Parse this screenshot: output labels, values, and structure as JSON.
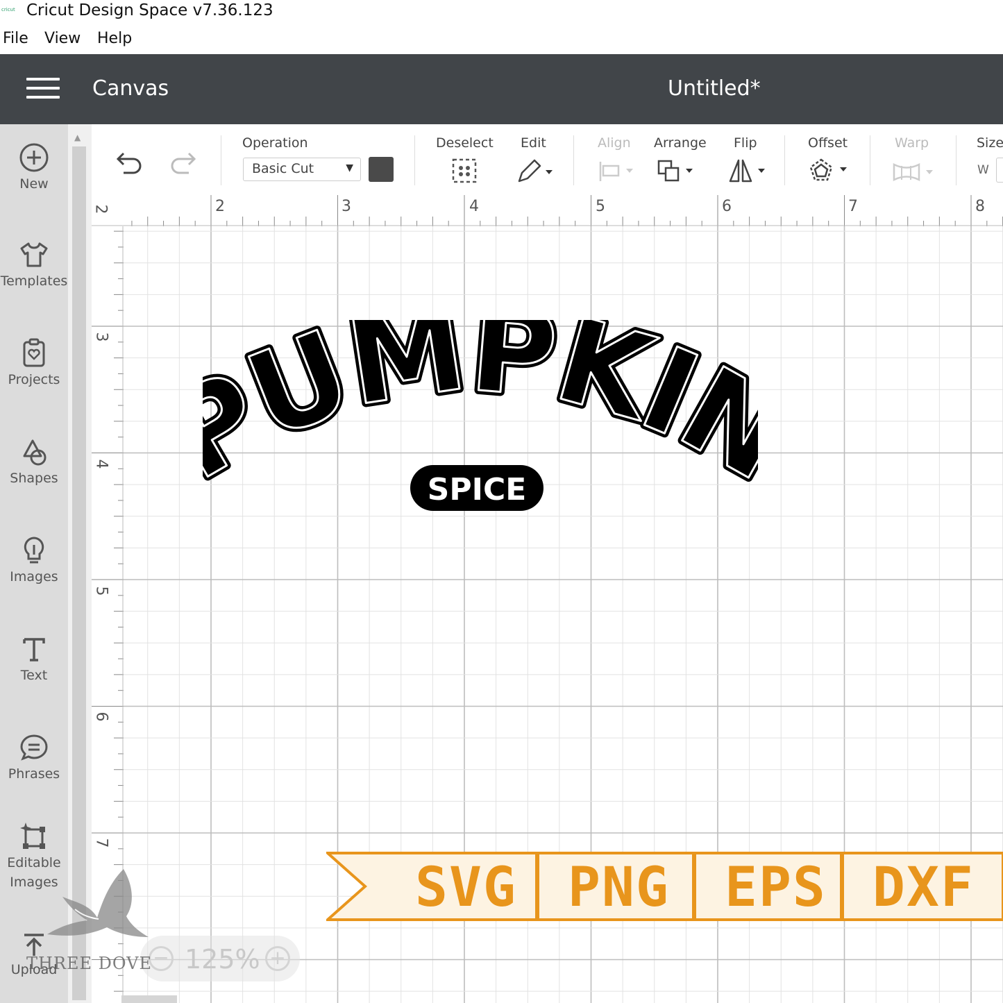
{
  "app": {
    "icon_text": "cricut",
    "title": "Cricut Design Space  v7.36.123"
  },
  "menu": [
    "File",
    "View",
    "Help"
  ],
  "header": {
    "section": "Canvas",
    "document_title": "Untitled*"
  },
  "left_nav": [
    {
      "label": "New",
      "icon": "plus-circle-icon"
    },
    {
      "label": "Templates",
      "icon": "shirt-icon"
    },
    {
      "label": "Projects",
      "icon": "clipboard-heart-icon"
    },
    {
      "label": "Shapes",
      "icon": "shapes-icon"
    },
    {
      "label": "Images",
      "icon": "lightbulb-icon"
    },
    {
      "label": "Text",
      "icon": "text-t-icon"
    },
    {
      "label": "Phrases",
      "icon": "speech-bubble-icon"
    },
    {
      "label": "Editable",
      "label2": "Images",
      "icon": "editable-image-icon"
    },
    {
      "label": "Upload",
      "icon": "upload-icon"
    }
  ],
  "toolbar": {
    "operation_label": "Operation",
    "operation_value": "Basic Cut",
    "operation_color": "#4a4a4a",
    "deselect_label": "Deselect",
    "edit_label": "Edit",
    "align_label": "Align",
    "arrange_label": "Arrange",
    "flip_label": "Flip",
    "offset_label": "Offset",
    "warp_label": "Warp",
    "size_label": "Size",
    "size_w_label": "W"
  },
  "ruler": {
    "top_numbers": [
      "2",
      "2",
      "3",
      "4",
      "5",
      "6",
      "7",
      "8"
    ],
    "left_numbers": [
      "2",
      "3",
      "4",
      "5",
      "6",
      "7"
    ]
  },
  "design": {
    "main_text": "PUMPKIN",
    "badge_text": "SPICE"
  },
  "banner": {
    "formats": [
      "SVG",
      "PNG",
      "EPS",
      "DXF"
    ],
    "accent_color": "#e8951c",
    "background_color": "#fdf3e2"
  },
  "watermark": {
    "text": "THREE DOVE"
  },
  "zoom": {
    "value": "125%",
    "minus": "−",
    "plus": "+"
  }
}
